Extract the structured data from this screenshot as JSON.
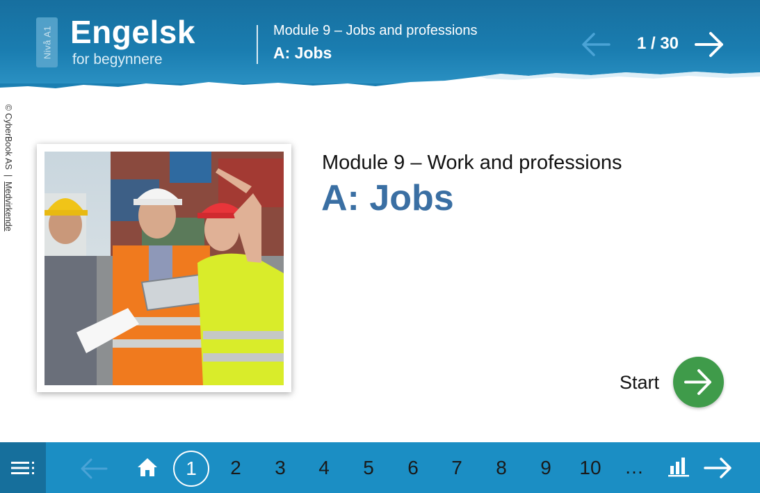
{
  "header": {
    "level_badge": "Nivå A1",
    "brand_title": "Engelsk",
    "brand_subtitle": "for begynnere",
    "module_title": "Module 9 – Jobs and professions",
    "section_title": "A: Jobs",
    "page_counter": "1 / 30"
  },
  "side": {
    "copyright": "© CyberBook AS",
    "separator": "|",
    "contributors_link": "Medvirkende"
  },
  "main": {
    "module_title": "Module 9 – Work and professions",
    "section_title": "A: Jobs",
    "start_label": "Start"
  },
  "footer": {
    "pages": [
      "1",
      "2",
      "3",
      "4",
      "5",
      "6",
      "7",
      "8",
      "9",
      "10"
    ],
    "current_page": "1",
    "ellipsis": "…"
  },
  "icons": {
    "header_prev": "arrow-left-icon",
    "header_next": "arrow-right-icon",
    "start": "arrow-right-icon",
    "menu": "menu-icon",
    "footer_prev": "arrow-left-icon",
    "home": "home-icon",
    "stats": "bar-chart-icon",
    "footer_next": "arrow-right-icon"
  },
  "colors": {
    "header_blue": "#1b7fb2",
    "footer_blue": "#1b8ec4",
    "title_blue": "#3a6fa3",
    "start_green": "#3f9b4a"
  }
}
